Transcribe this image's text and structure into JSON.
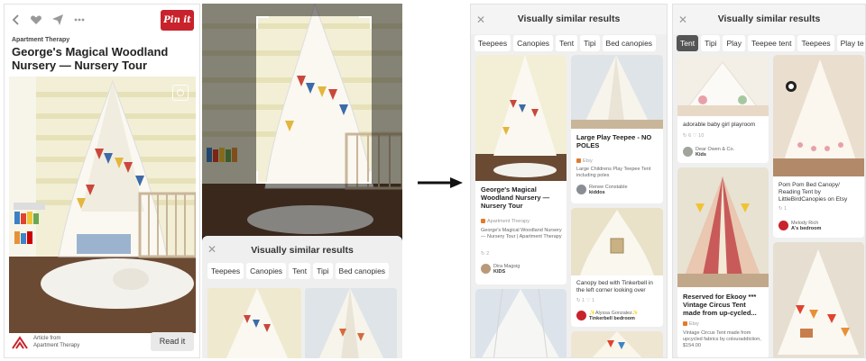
{
  "closeup": {
    "pin_button": "Pin it",
    "source_label": "Apartment Therapy",
    "title": "George's Magical Woodland Nursery — Nursery Tour",
    "article_from": "Article from",
    "article_source": "Apartment Therapy",
    "read_button": "Read it"
  },
  "visual_search": {
    "title": "Visually similar results",
    "chips": [
      "Teepees",
      "Canopies",
      "Tent",
      "Tipi",
      "Bed canopies"
    ]
  },
  "results_a": {
    "title": "Visually similar results",
    "chips": [
      "Teepees",
      "Canopies",
      "Tent",
      "Tipi",
      "Bed canopies"
    ],
    "cards": [
      {
        "title": "George's Magical Woodland Nursery — Nursery Tour",
        "source": "Apartment Therapy",
        "desc": "George's Magical Woodland Nursery — Nursery Tour | Apartment Therapy",
        "stats": "↻ 2",
        "user": "Dira Magsig",
        "board": "KIDS"
      },
      {
        "title": "Large Play Teepee - NO POLES",
        "source": "Etsy",
        "desc": "Large Childrens Play Teepee Tent including poles",
        "user": "Renee Constable",
        "board": "kiddos"
      },
      {
        "title": "Canopy bed with Tinkerbell in the left corner looking over",
        "stats": "↻ 1  ♡ 1",
        "user": "✨Alyssa Gonzalez✨",
        "board": "Tinkerbell bedroom"
      }
    ]
  },
  "results_b": {
    "title": "Visually similar results",
    "chips": [
      "Tent",
      "Tipi",
      "Play",
      "Teepee tent",
      "Teepees",
      "Play te"
    ],
    "selected_chip": "Tent",
    "cards": [
      {
        "title": "adorable baby girl playroom",
        "stats": "↻ 6  ♡ 10",
        "user": "Dear Owen & Co.",
        "board": "Kids"
      },
      {
        "title": "Pom Pom Bed Canopy/ Reading Tent by LittleBirdCanopies on Etsy",
        "stats": "↻ 1",
        "user": "Melody Rich",
        "board": "A's bedroom"
      },
      {
        "title": "Reserved for Ekooy *** Vintage Circus Tent made from up-cycled...",
        "source": "Etsy",
        "desc": "Vintage Circus Tent made from upcycled fabrics by colouraddiction, $154.00"
      }
    ]
  }
}
